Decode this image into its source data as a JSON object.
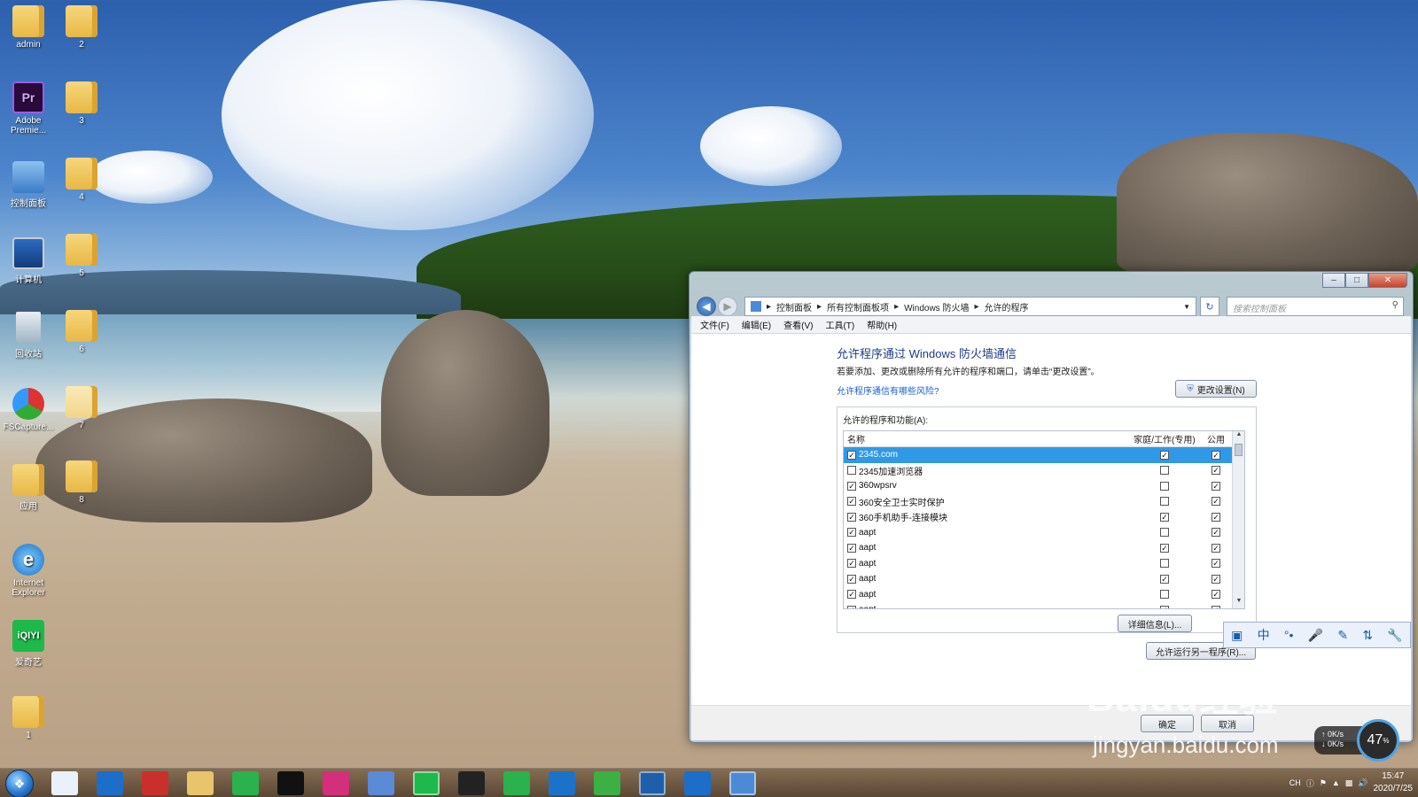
{
  "desktop": {
    "icons_col1": [
      {
        "label": "admin"
      },
      {
        "label": "Adobe Premie..."
      },
      {
        "label": "控制面板"
      },
      {
        "label": "计算机"
      },
      {
        "label": "回收站"
      },
      {
        "label": "FSCapture..."
      },
      {
        "label": "应用"
      },
      {
        "label": "Internet Explorer"
      },
      {
        "label": "爱奇艺"
      },
      {
        "label": "1"
      }
    ],
    "icons_col2": [
      {
        "label": "2"
      },
      {
        "label": "3"
      },
      {
        "label": "4"
      },
      {
        "label": "5"
      },
      {
        "label": "6"
      },
      {
        "label": "7"
      },
      {
        "label": "8"
      }
    ]
  },
  "window": {
    "breadcrumb": [
      "控制面板",
      "所有控制面板项",
      "Windows 防火墙",
      "允许的程序"
    ],
    "search_placeholder": "搜索控制面板",
    "menu": [
      "文件(F)",
      "编辑(E)",
      "查看(V)",
      "工具(T)",
      "帮助(H)"
    ],
    "heading": "允许程序通过 Windows 防火墙通信",
    "description": "若要添加、更改或删除所有允许的程序和端口，请单击“更改设置”。",
    "risk_link": "允许程序通信有哪些风险?",
    "change_settings": "更改设置(N)",
    "group_label": "允许的程序和功能(A):",
    "columns": {
      "name": "名称",
      "home": "家庭/工作(专用)",
      "public": "公用"
    },
    "rows": [
      {
        "name": "2345.com",
        "enabled": true,
        "home": true,
        "public": true,
        "selected": true
      },
      {
        "name": "2345加速浏览器",
        "enabled": false,
        "home": false,
        "public": true
      },
      {
        "name": "360wpsrv",
        "enabled": true,
        "home": false,
        "public": true
      },
      {
        "name": "360安全卫士实时保护",
        "enabled": true,
        "home": false,
        "public": true
      },
      {
        "name": "360手机助手-连接模块",
        "enabled": true,
        "home": true,
        "public": true
      },
      {
        "name": "aapt",
        "enabled": true,
        "home": false,
        "public": true
      },
      {
        "name": "aapt",
        "enabled": true,
        "home": true,
        "public": true
      },
      {
        "name": "aapt",
        "enabled": true,
        "home": false,
        "public": true
      },
      {
        "name": "aapt",
        "enabled": true,
        "home": true,
        "public": true
      },
      {
        "name": "aapt",
        "enabled": true,
        "home": false,
        "public": true
      },
      {
        "name": "aapt",
        "enabled": true,
        "home": true,
        "public": true
      }
    ],
    "details_button": "详细信息(L)...",
    "allow_other_button": "允许运行另一程序(R)...",
    "ok_button": "确定",
    "cancel_button": "取消"
  },
  "ime": {
    "items": [
      "中",
      "拼",
      "麦",
      "笔",
      "符",
      "设"
    ]
  },
  "watermark": {
    "line1": "Baidu经验",
    "line2": "jingyan.baidu.com"
  },
  "netmonitor": {
    "speed_up": "0",
    "unit": "K/s",
    "percent": "47",
    "percent_suffix": "%"
  },
  "taskbar": {
    "apps": [
      "chrome-icon",
      "ie-icon",
      "app-icon",
      "explorer-icon",
      "app2-icon",
      "qq-icon",
      "youku-icon",
      "bird-icon",
      "iqiyi-icon",
      "g-icon",
      "app3-icon",
      "k-icon",
      "player-icon",
      "browser-icon",
      "ie2-icon",
      "control-panel-icon"
    ],
    "lang": "CH",
    "time": "15:47",
    "date": "2020/7/25"
  }
}
